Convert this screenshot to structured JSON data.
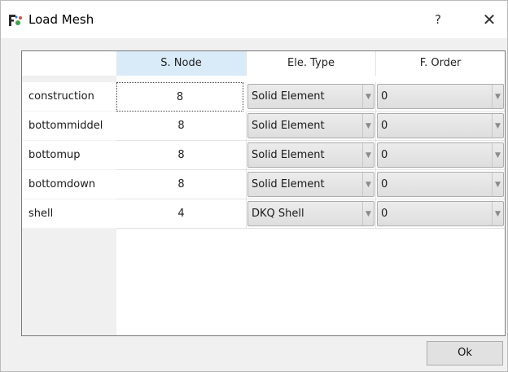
{
  "window": {
    "title": "Load Mesh",
    "help_symbol": "?",
    "close_symbol": "✕",
    "icon": "app-logo-icon"
  },
  "table": {
    "columns": [
      "S. Node",
      "Ele. Type",
      "F. Order"
    ],
    "rows": [
      {
        "label": "construction",
        "s_node": "8",
        "ele_type": "Solid Element",
        "f_order": "0"
      },
      {
        "label": "bottommiddel",
        "s_node": "8",
        "ele_type": "Solid Element",
        "f_order": "0"
      },
      {
        "label": "bottomup",
        "s_node": "8",
        "ele_type": "Solid Element",
        "f_order": "0"
      },
      {
        "label": "bottomdown",
        "s_node": "8",
        "ele_type": "Solid Element",
        "f_order": "0"
      },
      {
        "label": "shell",
        "s_node": "4",
        "ele_type": "DKQ Shell",
        "f_order": "0"
      }
    ]
  },
  "footer": {
    "ok_label": "Ok"
  },
  "colors": {
    "selected_header": "#d9ebf9",
    "combo_bg": "#e4e4e4",
    "dialog_bg": "#f0f0f0"
  }
}
